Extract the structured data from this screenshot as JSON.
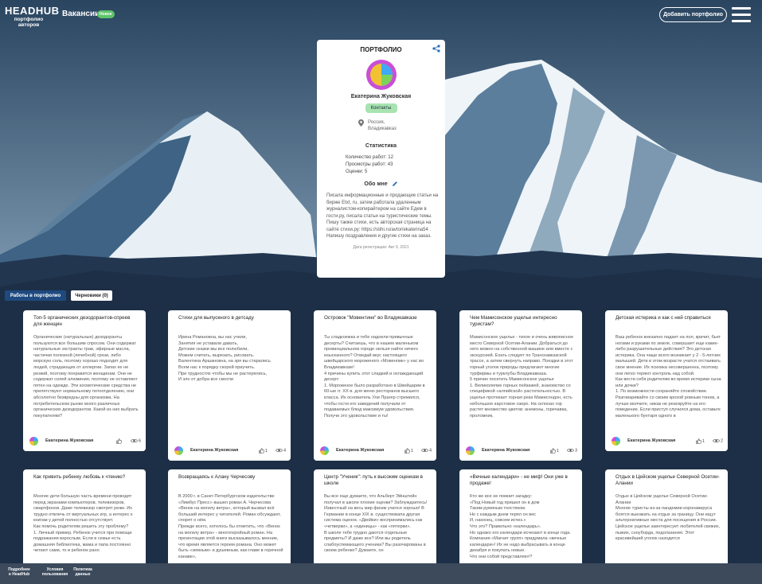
{
  "header": {
    "logo_title": "HEADHUB",
    "logo_sub_line1": "портфолио",
    "logo_sub_line2": "авторов",
    "nav_vacancies": "Вакансии",
    "badge_new": "Новое",
    "add_portfolio": "Добавить портфолио",
    "menu_icon": "hamburger-icon"
  },
  "profile": {
    "title": "ПОРТФОЛИО",
    "share_icon": "share-icon",
    "name": "Екатерина Жуковская",
    "contacts_label": "Контакты",
    "location_line1": "Россия,",
    "location_line2": "Владикавказ",
    "stats_title": "Статистика",
    "stats": {
      "works": "Количество работ: 12",
      "views": "Просмотры работ: 43",
      "ratings": "Оценки: 5"
    },
    "about_title": "Обо мне",
    "about_text": "Писала информационные и продающие статьи на бирже Etxt, ru, затем работала удаленным журналистом-копирайтером на сайте Едем в гости.ру, писала статьи на туристические темы. Пишу также стихи, есть авторская страница на сайте стихи.ру: https://stihi.ru/avtor/ekaterina54 . Напишу поздравления и другие стихи на заказ.",
    "reg_date": "Дата регистрации: Авг 9, 2021"
  },
  "tabs": {
    "works": "Работы в портфолио",
    "drafts": "Черновики (0)"
  },
  "cards": [
    {
      "title": "Топ-5 органических дезодорантов-спреев для женщин",
      "body": "Органические (натуральные) дезодоранты пользуются все большим спросом. Они содержат натуральные экстракты трав, эфирные масла, частички полезной (лечебной) грязи, либо морскую соль, поэтому хорошо подходят для людей, страдающих от аллергии. Запах их не резкий, поэтому понравится женщинам. Они не содержат солей алюминия, поэтому не оставляют пятен на одежде. Эти косметические средства не препятствуют нормальному потоотделению, они абсолютно безвредны для организма. На потребительском рынке много различных органических дезодорантов. Какой из них выбрать покупателям?",
      "author": "Екатерина Жуковская",
      "likes": "",
      "views": "6"
    },
    {
      "title": "Стихи для выпускного в детсаду",
      "body": "Ирина Романовна, вы нас учили,\nЗанятия не уставали давать,\nДетские сказки мы все полюбили,\nМожем считать, вырезать, рисовать.\n    Валентина Аршановна, на зря вы старались\n    Всем нас к порядку скорей приучить.\n    При трудностях чтобы мы не растерялись,\n    И зло от добра все смогли",
      "author": "Екатерина Жуковская",
      "likes": "1",
      "views": "4"
    },
    {
      "title": "Островок \"Мовентинк\" во Владикавказе",
      "body": "Ты сладкоежка и тебе надоели привычные десерты? Считаешь, что в нашем маленьком провинциальном городе нельзя найти ничего изысканного? Отведай вкус настоящего швейцарского мороженого «Мовенпик» у нас во Владикавказе!\n4   причины купить этот сладкий и охлаждающий десерт:\n1. Мороженое было разработано в Швейцарии в 60-ые гг. XX в. для меню ресторанов высшего класса. Их основатель Ули Прагер стремился, чтобы гости его заведений получали от подаваемых блюд максимум удовольствия. Получи это удовольствие и ты!",
      "author": "Екатерина Жуковская",
      "likes": "1",
      "views": "4"
    },
    {
      "title": "Чем Мамисонское ущелье интересно туристам?",
      "body": "Мамисонское ущелье - тихое и очень живописное место Северной Осетии-Алании. Добраться до него можно на собственной машине или вместе с экскурсией. Ехать следует по Транскавказской трассе, а затем свернуть направо. Поездки в этот горный уголок природы предлагают многие турфирмы и турклубы Владикавказа.\n5 причин посетить Мамисонское ущелье\n1. Великолепие горных пейзажей, знакомство со спецификой «алпийской» растительностью. В ущелье протекает горная река Мамисондон, есть небольшое карстовое озеро. На склонах гор растет множество цветов: анемоны, горечавка, проломник,",
      "author": "Екатерина Жуковская",
      "likes": "1",
      "views": "3"
    },
    {
      "title": "Детская истерика и как с ней справиться",
      "body": "Ваш ребенок внезапно падает на пол, кричит, бьет ногами и руками по земле, совершает еще какие-либо разрушительные действия? Это детская истерика. Она чаще всего возникает у 2 - 5-летних малышей. Дети в этом возрасте учатся отстаивать свое мнение. Их психика несовершенна, поэтому они легко теряют контроль над собой.\nКак вести себя родителям во время истерики сына или дочки?\n1. По возможности сохраняйте спокойствие. Разговаривайте со своим крохой ровным тоном, а лучше молчите, никак не реагируйте на его поведение. Если приступ случился дома, оставьте маленького бунтаря одного в",
      "author": "Екатерина Жуковская",
      "likes": "1",
      "views": "2"
    },
    {
      "title": "Как привить ребенку любовь к чтению?",
      "body": "Многие дети большую часть времени проводят перед экранами компьютеров, телевизоров, смартфонов. Даже телевизор смотрят реже. Их трудно отвлечь от виртуальных игр, а интерес к книгам у детей полностью отсутствует.\nКак помочь родителям решить эту проблему?\n1. Личный пример. Ребенок учится при помощи подражания взрослым. Если в семье есть домашняя библиотека, мама и папа постоянно читают сами, то и ребенок рано",
      "author": "",
      "likes": "",
      "views": ""
    },
    {
      "title": "Возвращаясь к Алану Черчесову",
      "body": "В 2000 г. в Санкт-Петербургском издательстве «Лимбус Пресс» вышел роман А. Черчесова «Венок на могилу ветра», который вызвал всё больший интерес у читателей. Роман обсуждают, спорят о нём.\nПрежде всего, хотелось бы отметить, что «Венок на могилу ветра» - многогеройный роман. На презентации этой книги высказывалось мнение, что время является героем романа. Оно может быть «земным» и душевным, как-главе в горечной канаве»,",
      "author": "",
      "likes": "",
      "views": ""
    },
    {
      "title": "Центр \"Ученик\": путь к высоким оценкам в школе",
      "body": "Вы все еще думаете, что Альберт Эйнштейн получал в школе плохие оценки? Заблуждаетесь! Известный на весь мир физик учился хорошо! В Германии в конце XIX в. существовала другая система оценок. «Двойки» воспринимались как «четверки», а «единицы» - как «пятерки».\nВ школе тебе трудно даются отдельные предметы? И даже все? Или вы родитель слабоуспевающего ученика? Вы разочарованы в своем ребенке? Думаете, он",
      "author": "",
      "likes": "",
      "views": ""
    },
    {
      "title": "«Вечные календари» - не миф! Они уже в продаже!",
      "body": "Кто же все не помнит загадку:\n«Под Новый год пришел он в дом\nТаким румяным толстяком.\nНо с каждым днем терял он вес\nИ, наконец, совсем исчез.»\nЧто это? Правильно «календарь».\nНо однако его календари исчезают в конце года. Компания «Магнит групп» придумала «вечные календари»! Их не надо выбрасывать в конце декабря и покупать новые.\nЧто они собой представляют?",
      "author": "",
      "likes": "",
      "views": ""
    },
    {
      "title": "Отдых в Цейском ущелье Северной Осетии-Алании",
      "body": "Отдых в Цейском ущелье Северной Осетии-Алании\nМногие туристы из-за пандемии коронавируса боятся выезжать на отдых за границу. Они ищут альтернативные места для посещения в России.\nЦейское ущелье заинтересует любителей свежих, пыжих, сноуборда, педолазания. Этот красивейший уголок находится",
      "author": "",
      "likes": "",
      "views": ""
    }
  ],
  "footer": {
    "link1_line1": "Подробнее",
    "link1_line2": "о HeadHub",
    "link2_line1": "Условия",
    "link2_line2": "пользования",
    "link3_line1": "Политика",
    "link3_line2": "данных"
  },
  "colors": {
    "accent": "#1f4a80",
    "contacts_green": "#a8e3b0",
    "badge_green": "#5ec46b",
    "footer_bg": "#3c4a5c"
  }
}
